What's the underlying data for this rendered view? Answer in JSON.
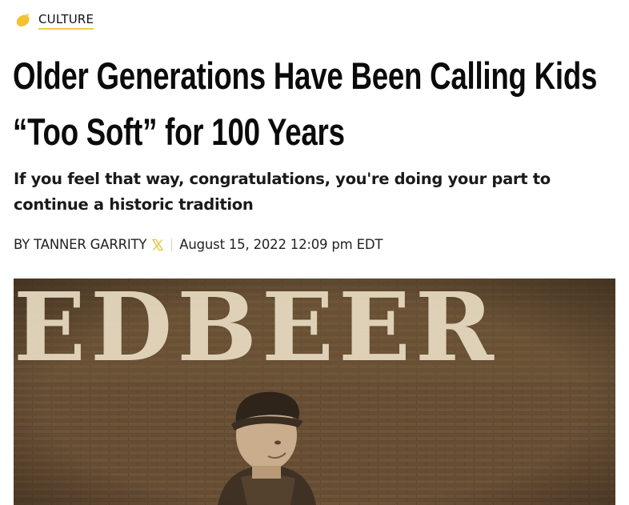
{
  "category": {
    "label": "CULTURE",
    "icon": "lemon-icon",
    "accent": "#f2c94c"
  },
  "article": {
    "headline": "Older Generations Have Been Calling Kids “Too Soft” for 100 Years",
    "dek": "If you feel that way, congratulations, you're doing your part to continue a historic tradition",
    "byline_prefix": "BY",
    "author": "TANNER GARRITY",
    "social_icon": "x-icon",
    "date": "August 15, 2022 12:09 pm EDT"
  },
  "hero": {
    "sign_text": "EDBEER",
    "tones": {
      "brick": "#6b5236",
      "letters": "#e8dcc2"
    }
  }
}
